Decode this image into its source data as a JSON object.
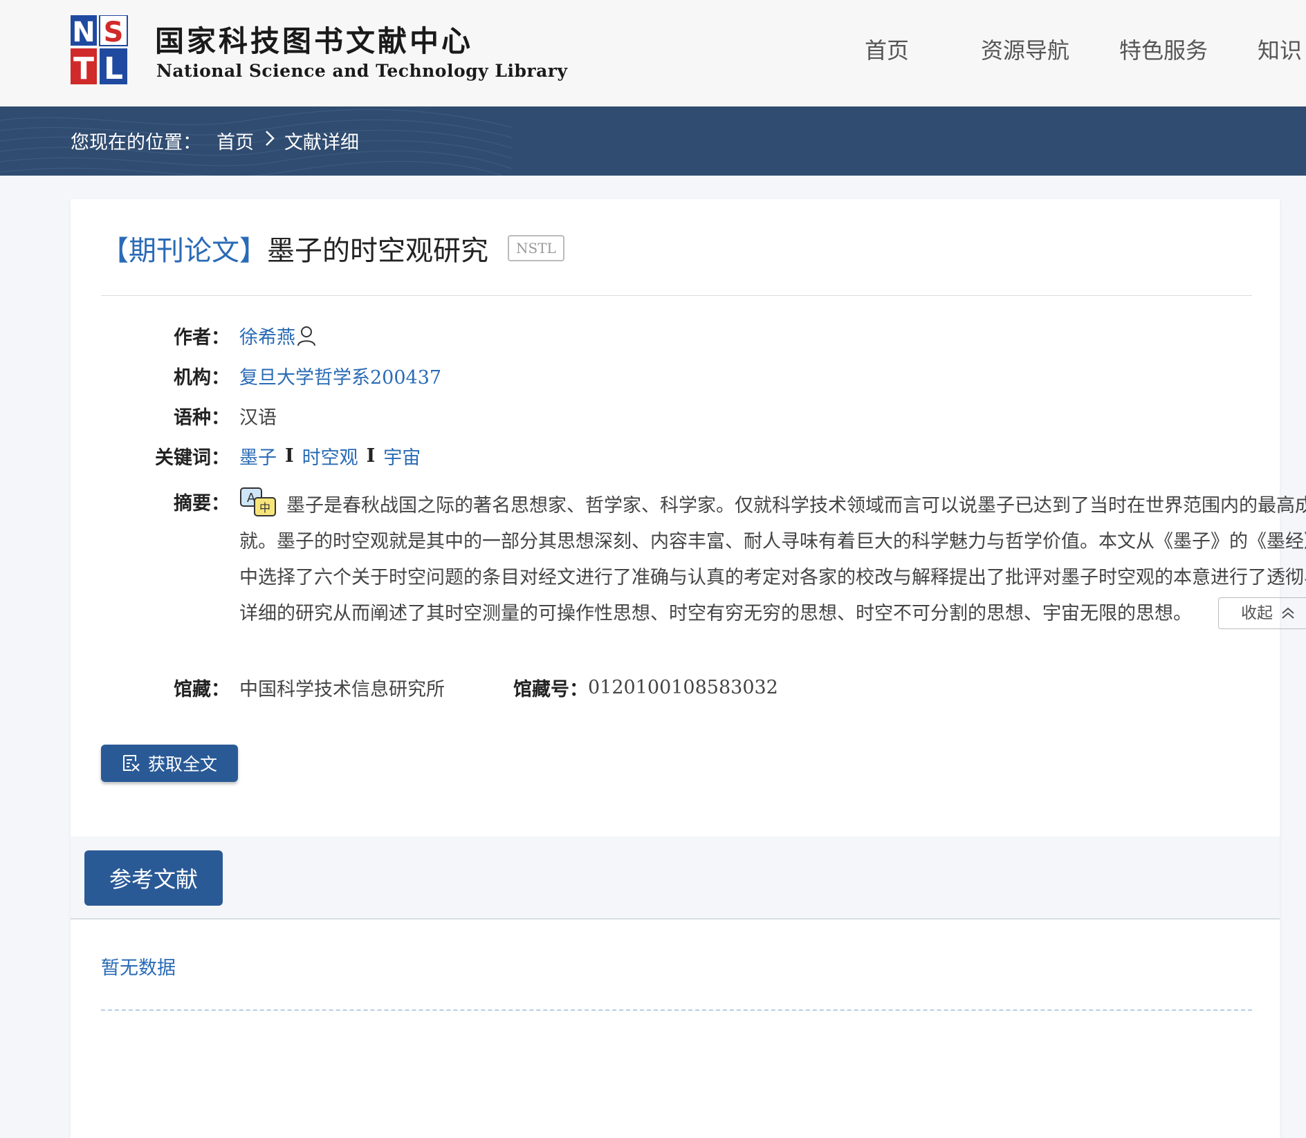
{
  "header": {
    "logo": {
      "mark_letters": [
        "N",
        "S",
        "T",
        "L"
      ],
      "cn_name": "国家科技图书文献中心",
      "en_name": "National Science and Technology Library"
    },
    "nav": [
      "首页",
      "资源导航",
      "特色服务",
      "知识"
    ]
  },
  "breadcrumb": {
    "prefix": "您现在的位置：",
    "items": [
      "首页",
      "文献详细"
    ],
    "separator_icon": "chevron-right-icon"
  },
  "record": {
    "type": "【期刊论文】",
    "title": "墨子的时空观研究",
    "badge": "NSTL",
    "author_label": "作者：",
    "author": "徐希燕",
    "author_icon": "person-icon",
    "org_label": "机构：",
    "org": "复旦大学哲学系200437",
    "lang_label": "语种：",
    "lang": "汉语",
    "kw_label": "关键词：",
    "keywords": [
      "墨子",
      "时空观",
      "宇宙"
    ],
    "kw_separator": "I",
    "abstract_label": "摘要：",
    "abstract_icon": "translate-icon",
    "abstract": "墨子是春秋战国之际的著名思想家、哲学家、科学家。仅就科学技术领域而言可以说墨子已达到了当时在世界范围内的最高成就。墨子的时空观就是其中的一部分其思想深刻、内容丰富、耐人寻味有着巨大的科学魅力与哲学价值。本文从《墨子》的《墨经》中选择了六个关于时空问题的条目对经文进行了准确与认真的考定对各家的校改与解释提出了批评对墨子时空观的本意进行了透彻与详细的研究从而阐述了其时空测量的可操作性思想、时空有穷无穷的思想、时空不可分割的思想、宇宙无限的思想。",
    "collapse_label": "收起",
    "holding_label": "馆藏：",
    "holding": "中国科学技术信息研究所",
    "callno_label": "馆藏号：",
    "callno": "0120100108583032",
    "get_fulltext": "获取全文"
  },
  "references": {
    "tab": "参考文献",
    "empty": "暂无数据"
  },
  "colors": {
    "accent": "#2a6bb6",
    "band": "#304c70",
    "button": "#2a5a96"
  }
}
